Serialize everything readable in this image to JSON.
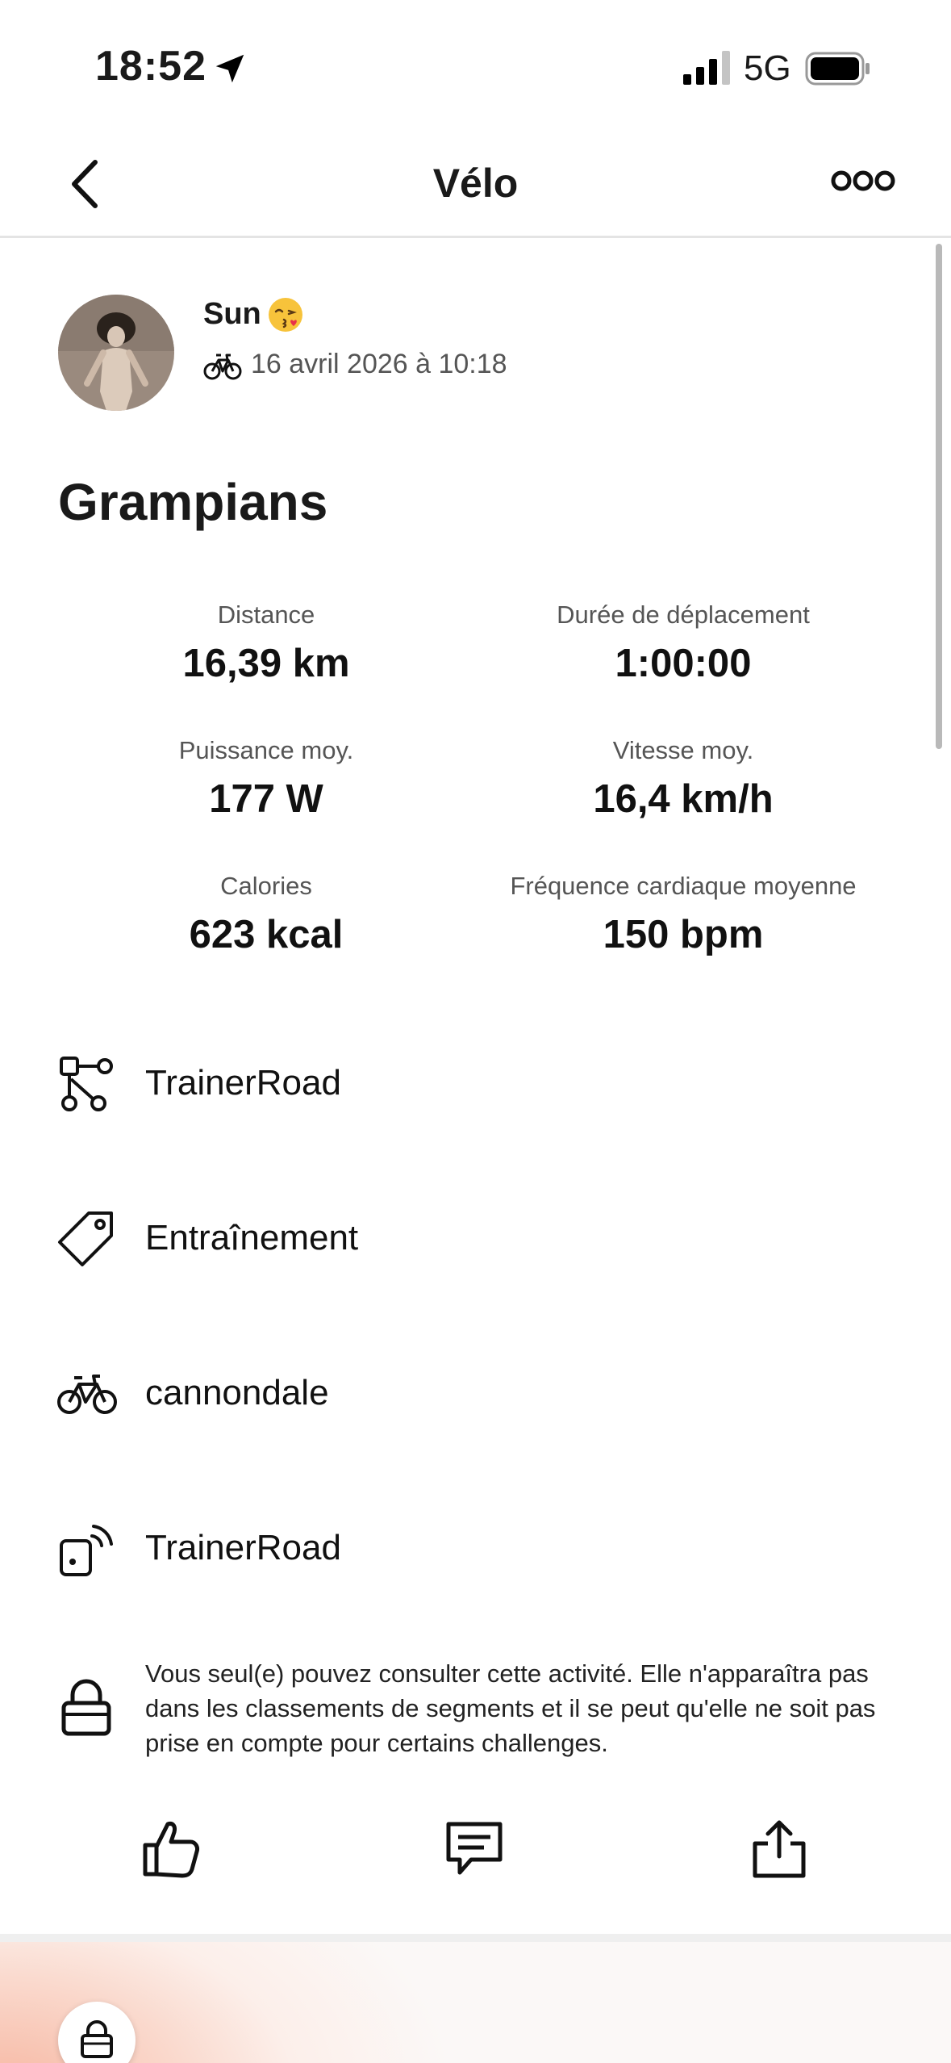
{
  "status_bar": {
    "time": "18:52",
    "network": "5G"
  },
  "nav": {
    "title": "Vélo"
  },
  "activity": {
    "athlete": "Sun",
    "date": "16 avril 2026 à 10:18",
    "title": "Grampians"
  },
  "stats": [
    {
      "label": "Distance",
      "value": "16,39 km"
    },
    {
      "label": "Durée de déplacement",
      "value": "1:00:00"
    },
    {
      "label": "Puissance moy.",
      "value": "177 W"
    },
    {
      "label": "Vitesse moy.",
      "value": "16,4 km/h"
    },
    {
      "label": "Calories",
      "value": "623 kcal"
    },
    {
      "label": "Fréquence cardiaque moyenne",
      "value": "150 bpm"
    }
  ],
  "details": [
    {
      "icon": "workout-route-icon",
      "text": "TrainerRoad"
    },
    {
      "icon": "tag-icon",
      "text": "Entraînement"
    },
    {
      "icon": "bike-icon",
      "text": "cannondale"
    },
    {
      "icon": "device-sync-icon",
      "text": "TrainerRoad"
    }
  ],
  "privacy": {
    "icon": "lock-icon",
    "text": "Vous seul(e) pouvez consulter cette activité. Elle n'apparaîtra pas dans les classements de segments et il se peut qu'elle ne soit pas prise en compte pour certains challenges."
  },
  "actions": [
    "thumbs-up-icon",
    "comment-icon",
    "share-icon"
  ],
  "colors": {
    "accent_gradient": "#f7b8a3",
    "divider": "#efefef"
  }
}
